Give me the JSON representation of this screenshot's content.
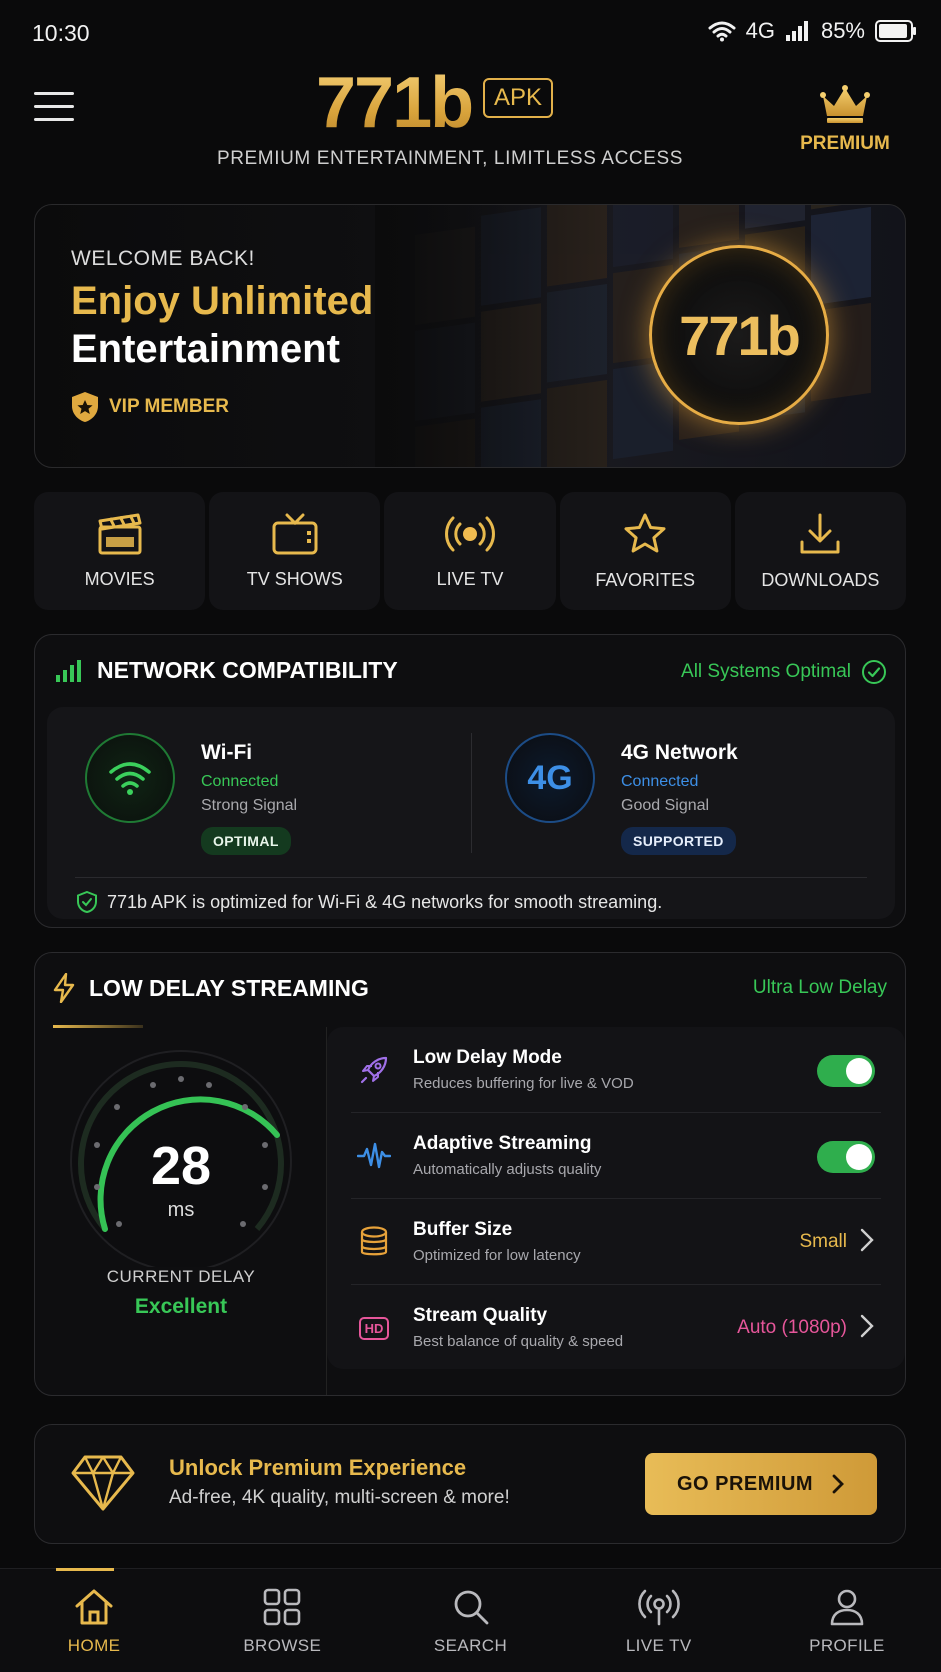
{
  "status_bar": {
    "time": "10:30",
    "network": "4G",
    "battery": "85%"
  },
  "header": {
    "logo": "771b",
    "badge": "APK",
    "tagline": "PREMIUM ENTERTAINMENT, LIMITLESS ACCESS",
    "premium_label": "PREMIUM"
  },
  "hero": {
    "welcome": "WELCOME BACK!",
    "headline_1": "Enjoy Unlimited",
    "headline_2": "Entertainment",
    "vip": "VIP MEMBER",
    "ring_logo": "771b"
  },
  "categories": [
    {
      "label": "MOVIES",
      "icon": "clapperboard-icon"
    },
    {
      "label": "TV SHOWS",
      "icon": "tv-icon"
    },
    {
      "label": "LIVE TV",
      "icon": "broadcast-icon"
    },
    {
      "label": "FAVORITES",
      "icon": "star-icon"
    },
    {
      "label": "DOWNLOADS",
      "icon": "download-icon"
    }
  ],
  "network": {
    "title": "NETWORK COMPATIBILITY",
    "status": "All Systems Optimal",
    "wifi": {
      "name": "Wi-Fi",
      "state": "Connected",
      "signal": "Strong Signal",
      "tag": "OPTIMAL"
    },
    "cell": {
      "icon_text": "4G",
      "name": "4G Network",
      "state": "Connected",
      "signal": "Good Signal",
      "tag": "SUPPORTED"
    },
    "note": "771b APK is optimized for Wi-Fi & 4G networks for smooth streaming."
  },
  "low_delay": {
    "title": "LOW DELAY STREAMING",
    "badge": "Ultra Low Delay",
    "delay_value": "28",
    "delay_unit": "ms",
    "current_label": "CURRENT DELAY",
    "rating": "Excellent",
    "settings": [
      {
        "name": "Low Delay Mode",
        "desc": "Reduces buffering for live & VOD",
        "toggle": true
      },
      {
        "name": "Adaptive Streaming",
        "desc": "Automatically adjusts quality",
        "toggle": true
      },
      {
        "name": "Buffer Size",
        "desc": "Optimized for low latency",
        "value": "Small"
      },
      {
        "name": "Stream Quality",
        "desc": "Best balance of quality & speed",
        "value": "Auto (1080p)",
        "hd": "HD"
      }
    ]
  },
  "promo": {
    "title": "Unlock Premium Experience",
    "subtitle": "Ad-free, 4K quality, multi-screen & more!",
    "button": "GO PREMIUM"
  },
  "bottom_nav": [
    {
      "label": "HOME"
    },
    {
      "label": "BROWSE"
    },
    {
      "label": "SEARCH"
    },
    {
      "label": "LIVE TV"
    },
    {
      "label": "PROFILE"
    }
  ],
  "colors": {
    "gold": "#e7b94d",
    "green": "#38c757",
    "blue": "#3d8fe6",
    "pink": "#e6569a",
    "bg": "#0a0a0b"
  }
}
